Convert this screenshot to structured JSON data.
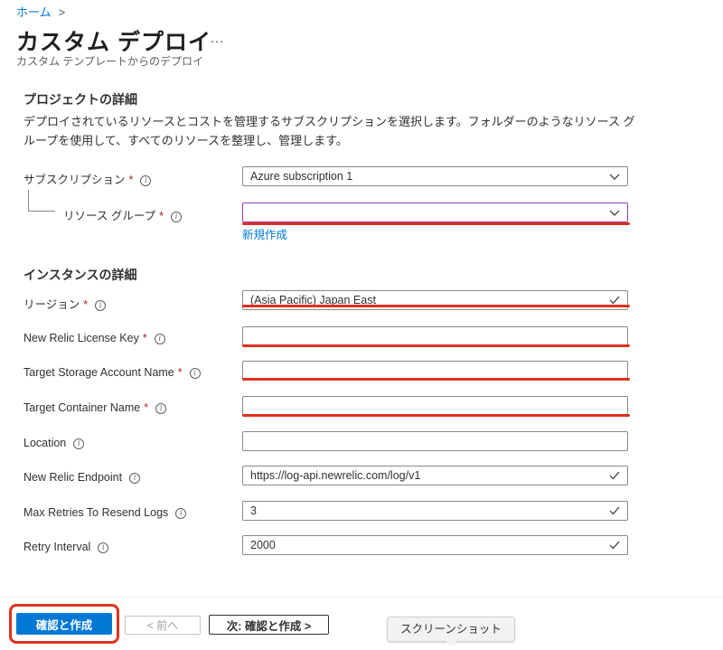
{
  "breadcrumb": {
    "home": "ホーム",
    "separator": ">"
  },
  "page": {
    "title": "カスタム デプロイ",
    "more": "…",
    "subtitle": "カスタム テンプレートからのデプロイ"
  },
  "project": {
    "heading": "プロジェクトの詳細",
    "description": "デプロイされているリソースとコストを管理するサブスクリプションを選択します。フォルダーのようなリソース グループを使用して、すべてのリソースを整理し、管理します。",
    "subscription": {
      "label": "サブスクリプション",
      "required": "*",
      "value": "Azure subscription 1"
    },
    "resource_group": {
      "label": "リソース グループ",
      "required": "*",
      "value": "",
      "create_new": "新規作成"
    }
  },
  "instance": {
    "heading": "インスタンスの詳細",
    "fields": [
      {
        "label": "リージョン",
        "required": "*",
        "value": "(Asia Pacific) Japan East"
      },
      {
        "label": "New Relic License Key",
        "required": "*",
        "value": ""
      },
      {
        "label": "Target Storage Account Name",
        "required": "*",
        "value": ""
      },
      {
        "label": "Target Container Name",
        "required": "*",
        "value": ""
      },
      {
        "label": "Location",
        "required": "",
        "value": ""
      },
      {
        "label": "New Relic Endpoint",
        "required": "",
        "value": "https://log-api.newrelic.com/log/v1"
      },
      {
        "label": "Max Retries To Resend Logs",
        "required": "",
        "value": "3"
      },
      {
        "label": "Retry Interval",
        "required": "",
        "value": "2000"
      }
    ]
  },
  "footer": {
    "review_create": "確認と作成",
    "previous": "< 前へ",
    "next": "次: 確認と作成 >",
    "tooltip": "スクリーンショット"
  },
  "colors": {
    "accent": "#0078d4",
    "highlight_red": "#e0301e",
    "required": "#a4262c"
  },
  "icons": [
    "chevron-down-icon",
    "checkmark-icon",
    "info-icon"
  ]
}
